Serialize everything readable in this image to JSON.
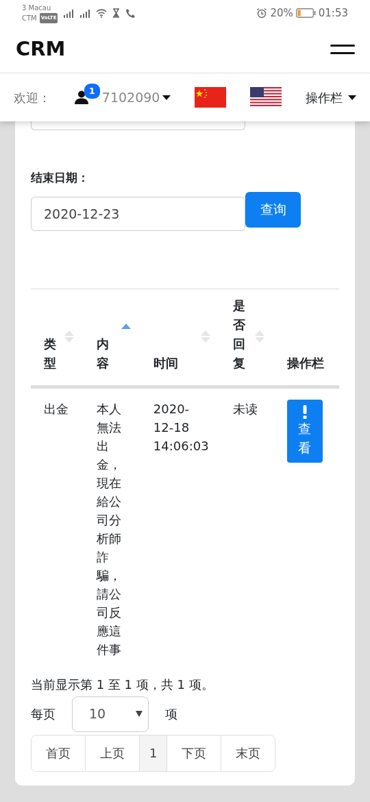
{
  "status_bar": {
    "carrier_line_1": "3 Macau",
    "carrier_line_2": "CTM",
    "volte": "VoLTE",
    "battery_text": "20%",
    "time": "01:53"
  },
  "navbar": {
    "brand": "CRM"
  },
  "user_bar": {
    "welcome": "欢迎：",
    "notification_count": "1",
    "user_id": "7102090",
    "menu": "操作栏"
  },
  "search": {
    "end_date_label": "结束日期：",
    "end_date": "2020-12-23",
    "query_button": "查询"
  },
  "table": {
    "columns": [
      {
        "label": "类型",
        "sortable": true,
        "sorted": false
      },
      {
        "label": "内容",
        "sortable": true,
        "sorted": true
      },
      {
        "label": "时间",
        "sortable": true,
        "sorted": false
      },
      {
        "label": "是否回复",
        "sortable": true,
        "sorted": false
      },
      {
        "label": "操作栏",
        "sortable": false
      }
    ],
    "rows": [
      {
        "type": "出金",
        "content": "本人無法出金，現在給公司分析師詐騙，請公司反應這件事",
        "time": "2020-12-18 14:06:03",
        "replied": "未读",
        "action": "查看"
      }
    ]
  },
  "info": "当前显示第 1 至 1 项，共 1 项。",
  "page_size": {
    "label_before": "每页",
    "value": "10",
    "label_after": "项"
  },
  "pagination": [
    {
      "label": "首页",
      "selected": false
    },
    {
      "label": "上页",
      "selected": false
    },
    {
      "label": "1",
      "selected": true
    },
    {
      "label": "下页",
      "selected": false
    },
    {
      "label": "末页",
      "selected": false
    }
  ]
}
